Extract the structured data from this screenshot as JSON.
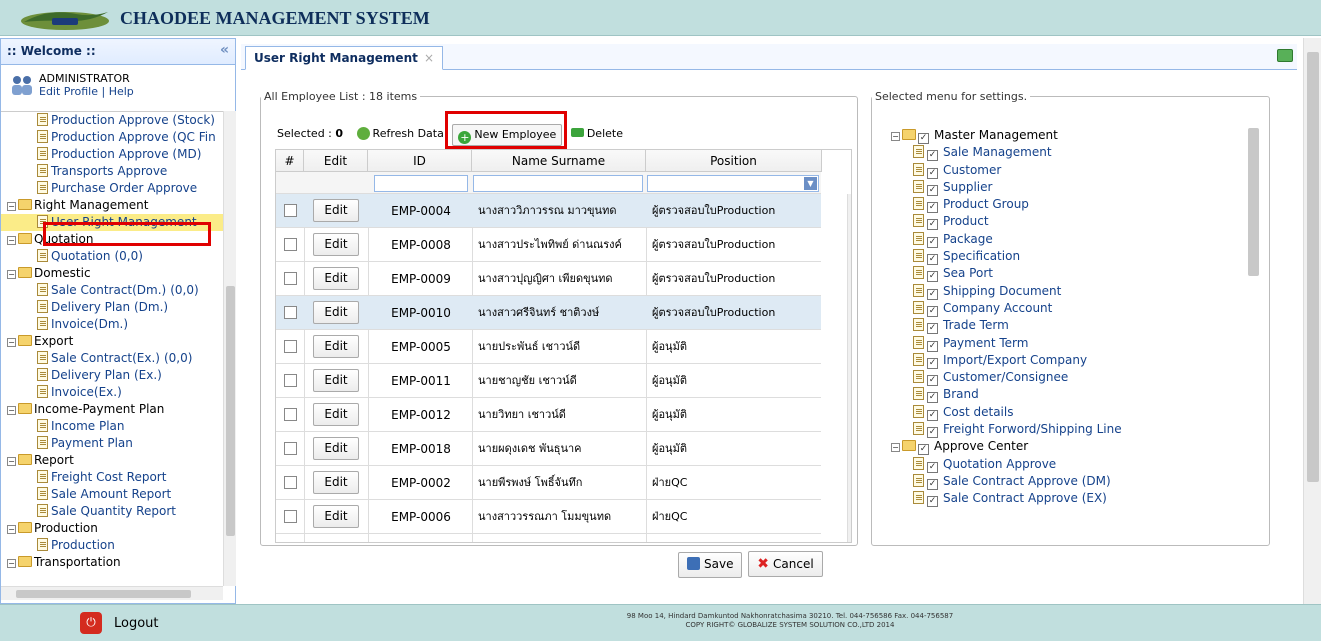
{
  "header": {
    "logo_text": "Chaodee",
    "app_title": "CHAODEE MANAGEMENT SYSTEM"
  },
  "sidebar": {
    "title": ":: Welcome ::",
    "user": {
      "name": "ADMINISTRATOR",
      "links": "Edit Profile | Help"
    },
    "tree": [
      {
        "label": "Production Approve (Stock)",
        "level": 2
      },
      {
        "label": "Production Approve (QC Fin",
        "level": 2
      },
      {
        "label": "Production Approve (MD)",
        "level": 2
      },
      {
        "label": "Transports Approve",
        "level": 2
      },
      {
        "label": "Purchase Order Approve",
        "level": 2
      },
      {
        "label": "Right Management",
        "level": 1
      },
      {
        "label": "User Right Management",
        "level": 2,
        "selected": true
      },
      {
        "label": "Quotation",
        "level": 1
      },
      {
        "label": "Quotation",
        "count": "(0,0)",
        "level": 2
      },
      {
        "label": "Domestic",
        "level": 1
      },
      {
        "label": "Sale Contract(Dm.)",
        "count": "(0,0)",
        "level": 2
      },
      {
        "label": "Delivery Plan (Dm.)",
        "level": 2
      },
      {
        "label": "Invoice(Dm.)",
        "level": 2
      },
      {
        "label": "Export",
        "level": 1
      },
      {
        "label": "Sale Contract(Ex.)",
        "count": "(0,0)",
        "level": 2
      },
      {
        "label": "Delivery Plan (Ex.)",
        "level": 2
      },
      {
        "label": "Invoice(Ex.)",
        "level": 2
      },
      {
        "label": "Income-Payment Plan",
        "level": 1
      },
      {
        "label": "Income Plan",
        "level": 2
      },
      {
        "label": "Payment Plan",
        "level": 2
      },
      {
        "label": "Report",
        "level": 1
      },
      {
        "label": "Freight Cost Report",
        "level": 2
      },
      {
        "label": "Sale Amount Report",
        "level": 2
      },
      {
        "label": "Sale Quantity Report",
        "level": 2
      },
      {
        "label": "Production",
        "level": 1
      },
      {
        "label": "Production",
        "level": 2
      },
      {
        "label": "Transportation",
        "level": 1
      }
    ]
  },
  "tab": {
    "label": "User Right Management",
    "close": "×"
  },
  "employee_list": {
    "legend": "All Employee List : 18 items",
    "selected_label": "Selected :",
    "selected_count": "0",
    "refresh_label": "Refresh Data",
    "new_label": "New Employee",
    "delete_label": "Delete",
    "columns": [
      "#",
      "Edit",
      "ID",
      "Name Surname",
      "Position"
    ],
    "edit_label": "Edit",
    "rows": [
      {
        "id": "EMP-0004",
        "name": "นางสาววิภาวรรณ มาวขุนทด",
        "position": "ผู้ตรวจสอบใบProduction",
        "alt": true
      },
      {
        "id": "EMP-0008",
        "name": "นางสาวประไพทิพย์ ด่านณรงค์",
        "position": "ผู้ตรวจสอบใบProduction",
        "alt": false
      },
      {
        "id": "EMP-0009",
        "name": "นางสาวปุญญิศา เพียดขุนทด",
        "position": "ผู้ตรวจสอบใบProduction",
        "alt": false
      },
      {
        "id": "EMP-0010",
        "name": "นางสาวศรีจินทร์ ชาติวงษ์",
        "position": "ผู้ตรวจสอบใบProduction",
        "alt": true
      },
      {
        "id": "EMP-0005",
        "name": "นายประพันธ์ เชาวน์ดี",
        "position": "ผู้อนุมัติ",
        "alt": false
      },
      {
        "id": "EMP-0011",
        "name": "นายชาญชัย เชาวน์ดี",
        "position": "ผู้อนุมัติ",
        "alt": false
      },
      {
        "id": "EMP-0012",
        "name": "นายวิทยา เชาวน์ดี",
        "position": "ผู้อนุมัติ",
        "alt": false
      },
      {
        "id": "EMP-0018",
        "name": "นายผดุงเดช พันธุนาค",
        "position": "ผู้อนุมัติ",
        "alt": false
      },
      {
        "id": "EMP-0002",
        "name": "นายพีรพงษ์ โพธิ์จันทึก",
        "position": "ฝ่ายQC",
        "alt": false
      },
      {
        "id": "EMP-0006",
        "name": "นางสาววรรณภา โมมขุนทด",
        "position": "ฝ่ายQC",
        "alt": false
      }
    ]
  },
  "menu_settings": {
    "legend": "Selected menu for settings.",
    "items": [
      {
        "label": "Master Management",
        "folder": true
      },
      {
        "label": "Sale Management"
      },
      {
        "label": "Customer"
      },
      {
        "label": "Supplier"
      },
      {
        "label": "Product Group"
      },
      {
        "label": "Product"
      },
      {
        "label": "Package"
      },
      {
        "label": "Specification"
      },
      {
        "label": "Sea Port"
      },
      {
        "label": "Shipping Document"
      },
      {
        "label": "Company Account"
      },
      {
        "label": "Trade Term"
      },
      {
        "label": "Payment Term"
      },
      {
        "label": "Import/Export Company"
      },
      {
        "label": "Customer/Consignee"
      },
      {
        "label": "Brand"
      },
      {
        "label": "Cost details"
      },
      {
        "label": "Freight Forword/Shipping Line"
      },
      {
        "label": "Approve Center",
        "folder": true
      },
      {
        "label": "Quotation Approve"
      },
      {
        "label": "Sale Contract Approve (DM)"
      },
      {
        "label": "Sale Contract Approve (EX)"
      }
    ]
  },
  "buttons": {
    "save": "Save",
    "cancel": "Cancel"
  },
  "footer": {
    "logout": "Logout",
    "line1": "98 Moo 14, Hindard Damkuntod Nakhonratchasima 30210. Tel. 044-756586 Fax. 044-756587",
    "line2": "COPY RIGHT© GLOBALIZE SYSTEM SOLUTION CO.,LTD 2014"
  }
}
